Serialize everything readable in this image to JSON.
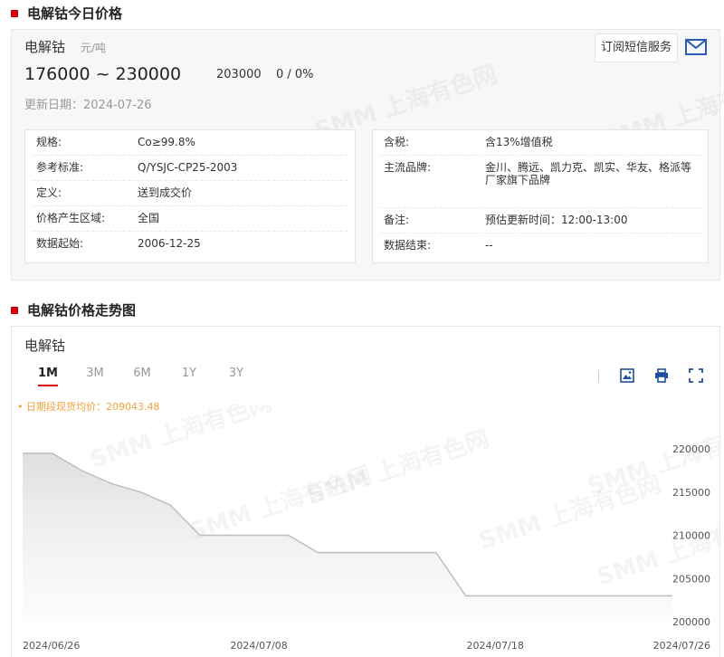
{
  "section1": {
    "title": "电解钴今日价格"
  },
  "price": {
    "name": "电解钴",
    "unit": "元/吨",
    "range": "176000 ~ 230000",
    "average": "203000",
    "change": "0 / 0%",
    "update_date": "更新日期：2024-07-26",
    "subscribe_label": "订阅短信服务"
  },
  "specs_left": [
    {
      "label": "规格:",
      "value": "Co≥99.8%"
    },
    {
      "label": "参考标准:",
      "value": "Q/YSJC-CP25-2003"
    },
    {
      "label": "定义:",
      "value": "送到成交价"
    },
    {
      "label": "价格产生区域:",
      "value": "全国"
    },
    {
      "label": "数据起始:",
      "value": "2006-12-25"
    }
  ],
  "specs_right": [
    {
      "label": "含税:",
      "value": "含13%增值税"
    },
    {
      "label": "主流品牌:",
      "value": "金川、腾远、凯力克、凯实、华友、格派等厂家旗下品牌"
    },
    {
      "label": "备注:",
      "value": "预估更新时间：12:00-13:00"
    },
    {
      "label": "数据结束:",
      "value": "--"
    }
  ],
  "section2": {
    "title": "电解钴价格走势图"
  },
  "chart_card": {
    "name": "电解钴",
    "tabs": [
      "1M",
      "3M",
      "6M",
      "1Y",
      "3Y"
    ],
    "active_tab": "1M",
    "avg_label": "日期段现货均价：209043.48",
    "icons": [
      "image-download-icon",
      "print-icon",
      "fullscreen-icon"
    ]
  },
  "watermark": "SMM 上海有色网",
  "chart_data": {
    "type": "area",
    "x": [
      "2024/06/26",
      "2024/06/27",
      "2024/06/28",
      "2024/07/01",
      "2024/07/02",
      "2024/07/03",
      "2024/07/04",
      "2024/07/05",
      "2024/07/08",
      "2024/07/09",
      "2024/07/10",
      "2024/07/11",
      "2024/07/12",
      "2024/07/15",
      "2024/07/16",
      "2024/07/17",
      "2024/07/18",
      "2024/07/19",
      "2024/07/22",
      "2024/07/23",
      "2024/07/24",
      "2024/07/25",
      "2024/07/26"
    ],
    "values": [
      219500,
      219500,
      217500,
      216000,
      215000,
      213500,
      210000,
      210000,
      210000,
      210000,
      208000,
      208000,
      208000,
      208000,
      208000,
      203000,
      203000,
      203000,
      203000,
      203000,
      203000,
      203000,
      203000
    ],
    "x_tick_labels": [
      "2024/06/26",
      "2024/07/08",
      "2024/07/18",
      "2024/07/26"
    ],
    "y_ticks": [
      200000,
      205000,
      210000,
      215000,
      220000
    ],
    "ylim": [
      200000,
      222000
    ],
    "line_color": "#bdbdbd",
    "fill_color": "#e8e8e8",
    "grid": false
  }
}
